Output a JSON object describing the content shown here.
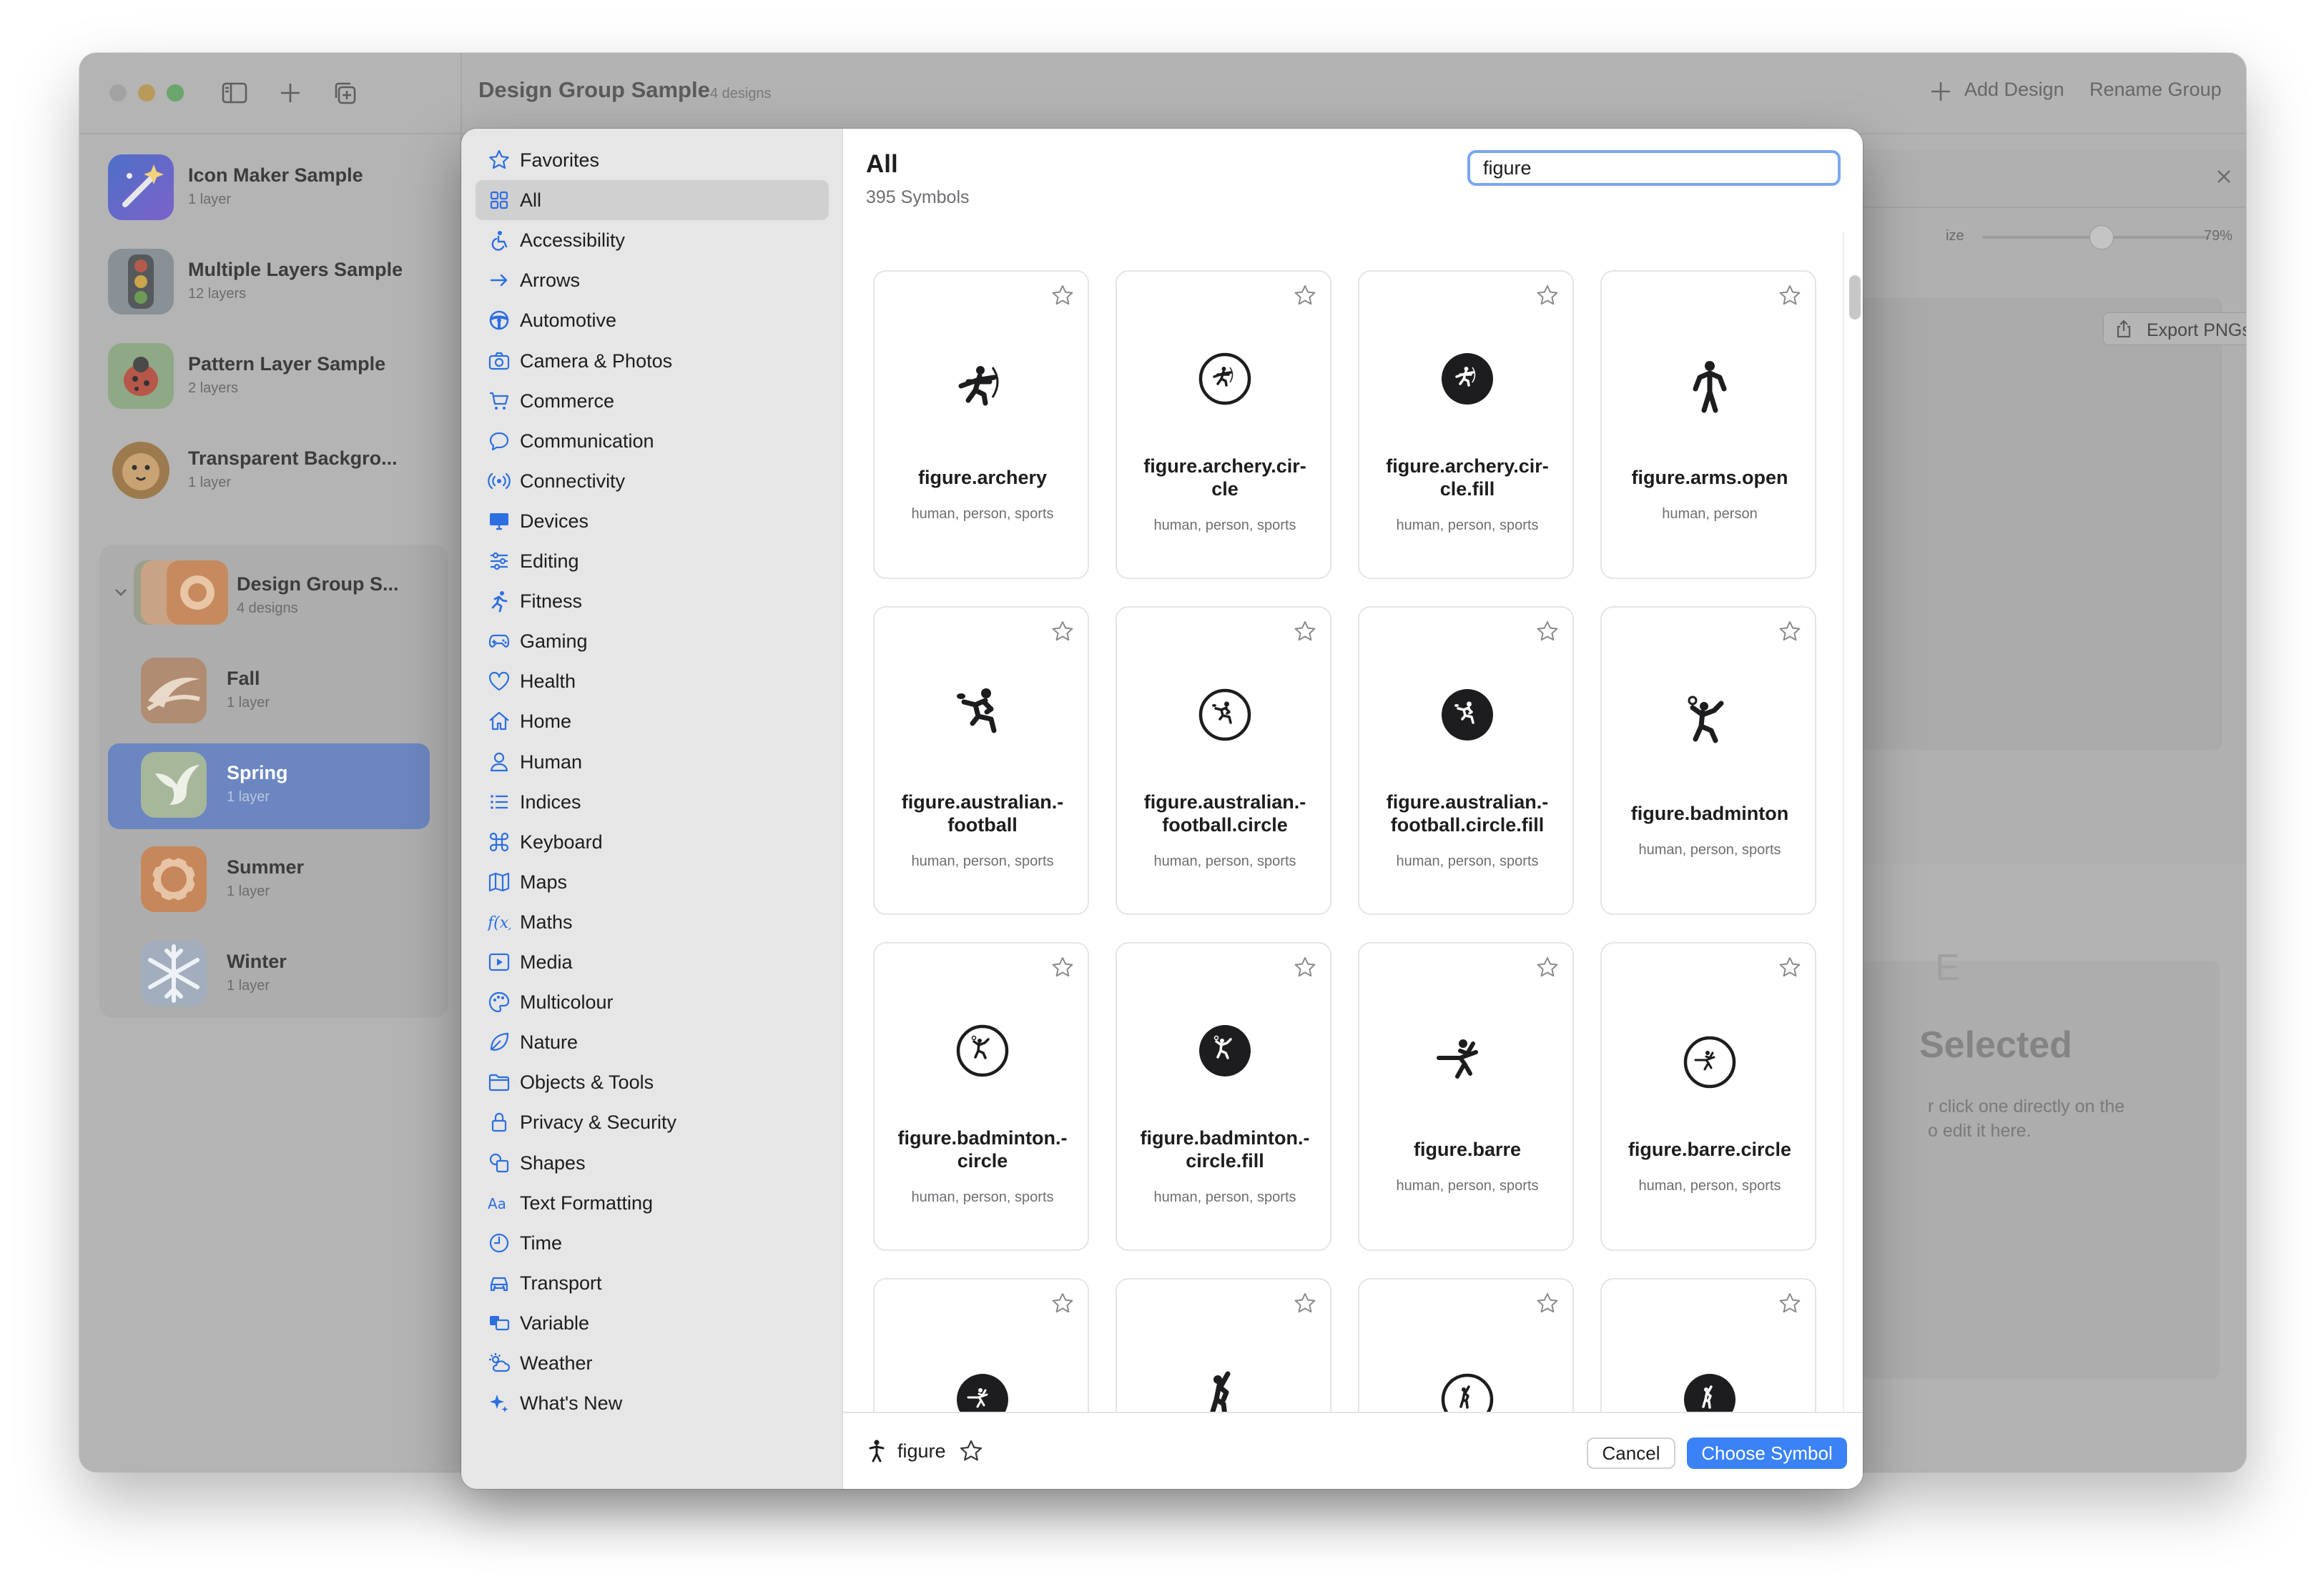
{
  "window": {
    "title": "Design Group Sample",
    "count": "4 designs",
    "toolbar": {
      "add_design": "Add Design",
      "rename_group": "Rename Group"
    }
  },
  "sidebar": {
    "items": [
      {
        "title": "Icon Maker Sample",
        "sub": "1 layer"
      },
      {
        "title": "Multiple Layers Sample",
        "sub": "12 layers"
      },
      {
        "title": "Pattern Layer Sample",
        "sub": "2 layers"
      },
      {
        "title": "Transparent Backgro...",
        "sub": "1 layer"
      }
    ],
    "group": {
      "title": "Design Group S...",
      "sub": "4 designs",
      "children": [
        {
          "title": "Fall",
          "sub": "1 layer"
        },
        {
          "title": "Spring",
          "sub": "1 layer",
          "selected": true
        },
        {
          "title": "Summer",
          "sub": "1 layer"
        },
        {
          "title": "Winter",
          "sub": "1 layer"
        }
      ]
    }
  },
  "inspector": {
    "size_label": "ize",
    "size_value": "79%",
    "size_fraction": 0.52,
    "export": "Export PNGs",
    "empty_title": "Selected",
    "empty_line1": "r click one directly on the",
    "empty_line2": "o edit it here."
  },
  "picker": {
    "title": "All",
    "count": "395 Symbols",
    "search_value": "figure",
    "categories": [
      {
        "label": "Favorites",
        "icon": "star-icon"
      },
      {
        "label": "All",
        "icon": "grid-icon",
        "selected": true
      },
      {
        "label": "Accessibility",
        "icon": "accessibility-icon"
      },
      {
        "label": "Arrows",
        "icon": "arrow-icon"
      },
      {
        "label": "Automotive",
        "icon": "steering-wheel-icon"
      },
      {
        "label": "Camera & Photos",
        "icon": "camera-icon"
      },
      {
        "label": "Commerce",
        "icon": "cart-icon"
      },
      {
        "label": "Communication",
        "icon": "speech-bubble-icon"
      },
      {
        "label": "Connectivity",
        "icon": "antenna-icon"
      },
      {
        "label": "Devices",
        "icon": "display-icon"
      },
      {
        "label": "Editing",
        "icon": "sliders-icon"
      },
      {
        "label": "Fitness",
        "icon": "running-figure-icon"
      },
      {
        "label": "Gaming",
        "icon": "gamecontroller-icon"
      },
      {
        "label": "Health",
        "icon": "heart-icon"
      },
      {
        "label": "Home",
        "icon": "house-icon"
      },
      {
        "label": "Human",
        "icon": "person-icon"
      },
      {
        "label": "Indices",
        "icon": "list-icon"
      },
      {
        "label": "Keyboard",
        "icon": "command-icon"
      },
      {
        "label": "Maps",
        "icon": "map-icon"
      },
      {
        "label": "Maths",
        "icon": "function-icon"
      },
      {
        "label": "Media",
        "icon": "play-rectangle-icon"
      },
      {
        "label": "Multicolour",
        "icon": "palette-icon"
      },
      {
        "label": "Nature",
        "icon": "leaf-icon"
      },
      {
        "label": "Objects & Tools",
        "icon": "folder-icon"
      },
      {
        "label": "Privacy & Security",
        "icon": "lock-icon"
      },
      {
        "label": "Shapes",
        "icon": "shapes-icon"
      },
      {
        "label": "Text Formatting",
        "icon": "textformat-icon"
      },
      {
        "label": "Time",
        "icon": "clock-icon"
      },
      {
        "label": "Transport",
        "icon": "car-icon"
      },
      {
        "label": "Variable",
        "icon": "variable-icon"
      },
      {
        "label": "Weather",
        "icon": "sun-cloud-icon"
      },
      {
        "label": "What's New",
        "icon": "sparkles-icon"
      }
    ],
    "symbols": [
      {
        "name": "figure.archery",
        "tags": "human, person, sports",
        "glyph": "archer"
      },
      {
        "name": "figure.archery.cir-\ncle",
        "tags": "human, person, sports",
        "glyph": "archer-circle"
      },
      {
        "name": "figure.archery.cir-\ncle.fill",
        "tags": "human, person, sports",
        "glyph": "archer-circle-fill"
      },
      {
        "name": "figure.arms.open",
        "tags": "human, person",
        "glyph": "arms-open"
      },
      {
        "name": "figure.australian.-\nfootball",
        "tags": "human, person, sports",
        "glyph": "kick"
      },
      {
        "name": "figure.australian.-\nfootball.circle",
        "tags": "human, person, sports",
        "glyph": "kick-circle"
      },
      {
        "name": "figure.australian.-\nfootball.circle.fill",
        "tags": "human, person, sports",
        "glyph": "kick-circle-fill"
      },
      {
        "name": "figure.badminton",
        "tags": "human, person, sports",
        "glyph": "badminton"
      },
      {
        "name": "figure.badminton.-\ncircle",
        "tags": "human, person, sports",
        "glyph": "badminton-circle"
      },
      {
        "name": "figure.badminton.-\ncircle.fill",
        "tags": "human, person, sports",
        "glyph": "badminton-circle-fill"
      },
      {
        "name": "figure.barre",
        "tags": "human, person, sports",
        "glyph": "barre"
      },
      {
        "name": "figure.barre.circle",
        "tags": "human, person, sports",
        "glyph": "barre-circle"
      },
      {
        "name": "",
        "tags": "",
        "glyph": "barre-circle-fill"
      },
      {
        "name": "",
        "tags": "",
        "glyph": "baseball"
      },
      {
        "name": "",
        "tags": "",
        "glyph": "baseball-circle"
      },
      {
        "name": "",
        "tags": "",
        "glyph": "baseball-circle-fill"
      }
    ],
    "footer": {
      "symbol_name": "figure",
      "cancel": "Cancel",
      "choose": "Choose Symbol"
    }
  }
}
